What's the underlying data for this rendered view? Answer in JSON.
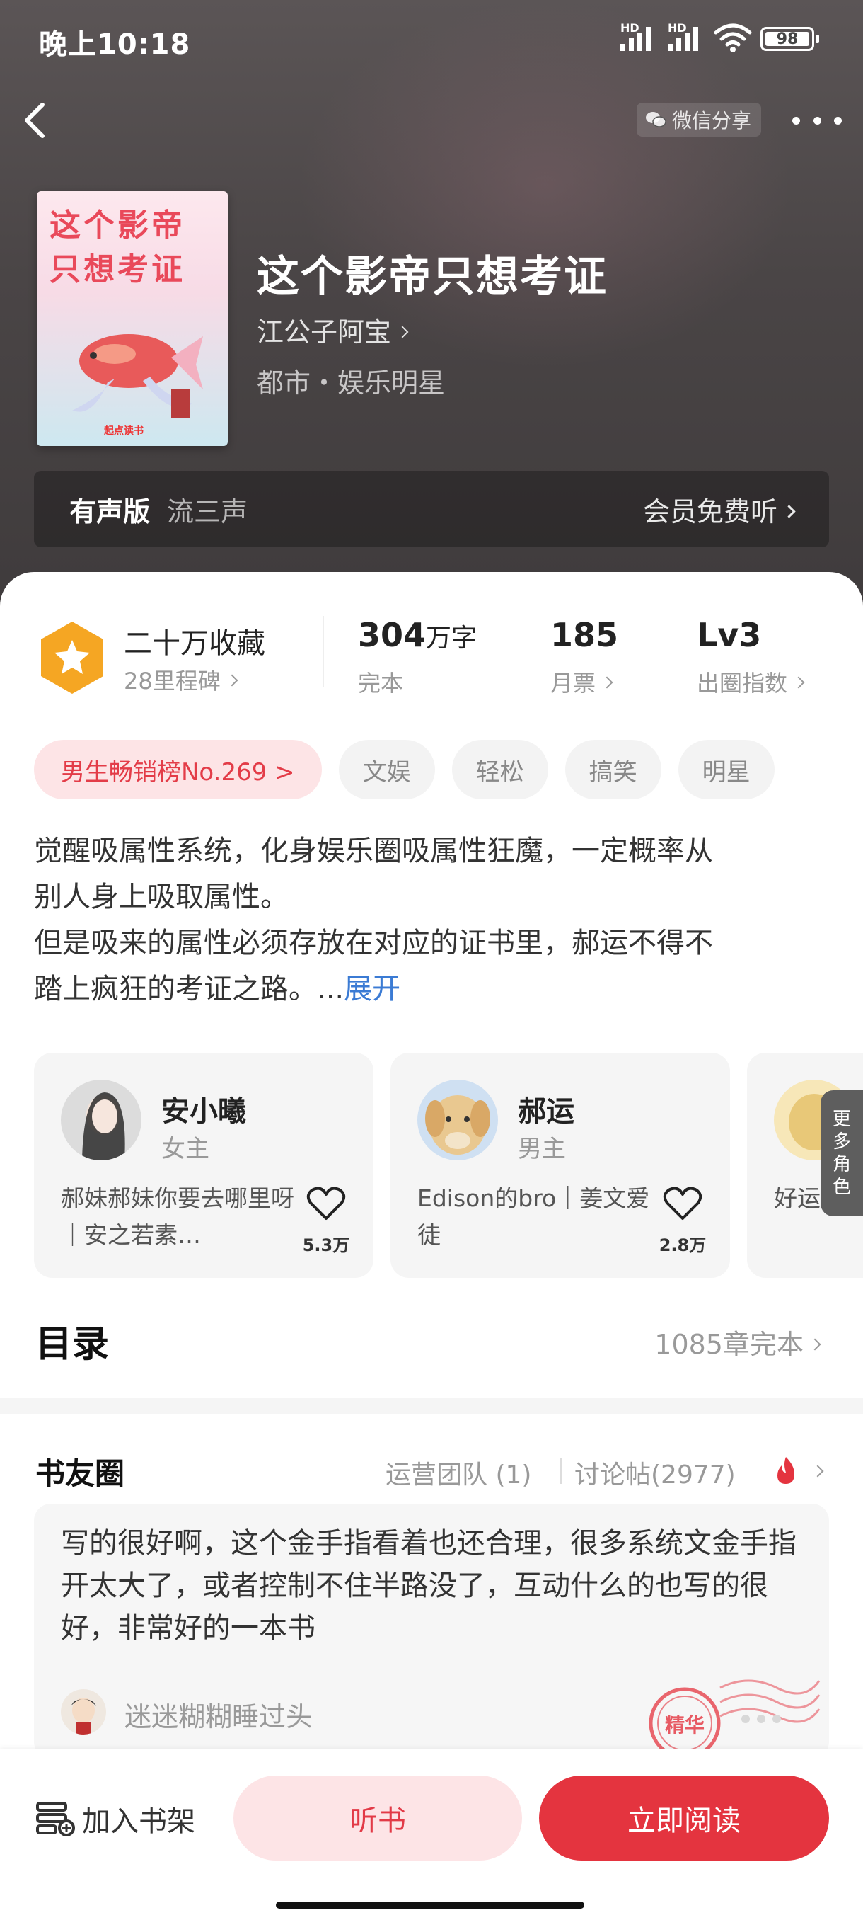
{
  "status_bar": {
    "time": "晚上10:18",
    "battery": "98",
    "network_label": "HD"
  },
  "nav": {
    "share_label": "微信分享"
  },
  "book": {
    "cover_title_line1": "这个影帝",
    "cover_title_line2": "只想考证",
    "cover_publisher": "起点读书",
    "title": "这个影帝只想考证",
    "author": "江公子阿宝",
    "genre": "都市・娱乐明星"
  },
  "audio": {
    "label": "有声版",
    "narrator": "流三声",
    "cta": "会员免费听"
  },
  "stats": {
    "collect": "二十万收藏",
    "milestone": "28里程碑",
    "words_num": "304",
    "words_unit": "万字",
    "status": "完本",
    "votes_num": "185",
    "votes_label": "月票",
    "level": "Lv3",
    "level_label": "出圈指数"
  },
  "tags": [
    "男生畅销榜No.269 >",
    "文娱",
    "轻松",
    "搞笑",
    "明星"
  ],
  "intro": {
    "text": "觉醒吸属性系统，化身娱乐圈吸属性狂魔，一定概率从别人身上吸取属性。\n但是吸来的属性必须存放在对应的证书里，郝运不得不踏上疯狂的考证之路。...",
    "line1": "觉醒吸属性系统，化身娱乐圈吸属性狂魔，一定概率从",
    "line2": "别人身上吸取属性。",
    "line3": "但是吸来的属性必须存放在对应的证书里，郝运不得不",
    "line4": "踏上疯狂的考证之路。...",
    "expand": "展开"
  },
  "roles": [
    {
      "name": "安小曦",
      "role": "女主",
      "desc": "郝妹郝妹你要去哪里呀｜安之若素…",
      "likes": "5.3万"
    },
    {
      "name": "郝运",
      "role": "男主",
      "desc": "Edison的bro｜姜文爱徒",
      "likes": "2.8万"
    },
    {
      "name": "",
      "role": "",
      "desc": "好运僚机",
      "likes": ""
    }
  ],
  "more_roles": "更多角色",
  "toc": {
    "title": "目录",
    "summary": "1085章完本"
  },
  "circle": {
    "title": "书友圈",
    "team": "运营团队 (1)",
    "posts": "讨论帖(2977)",
    "post_text": "写的很好啊，这个金手指看着也还合理，很多系统文金手指开太大了，或者控制不住半路没了，互动什么的也写的很好，非常好的一本书",
    "post_user": "迷迷糊糊睡过头",
    "stamp_label": "精华"
  },
  "bottom": {
    "shelf": "加入书架",
    "listen": "听书",
    "read": "立即阅读"
  },
  "colors": {
    "accent": "#e4343f",
    "accent_soft": "#fde4e6",
    "link": "#3b7bd4",
    "badge": "#f5a623"
  }
}
